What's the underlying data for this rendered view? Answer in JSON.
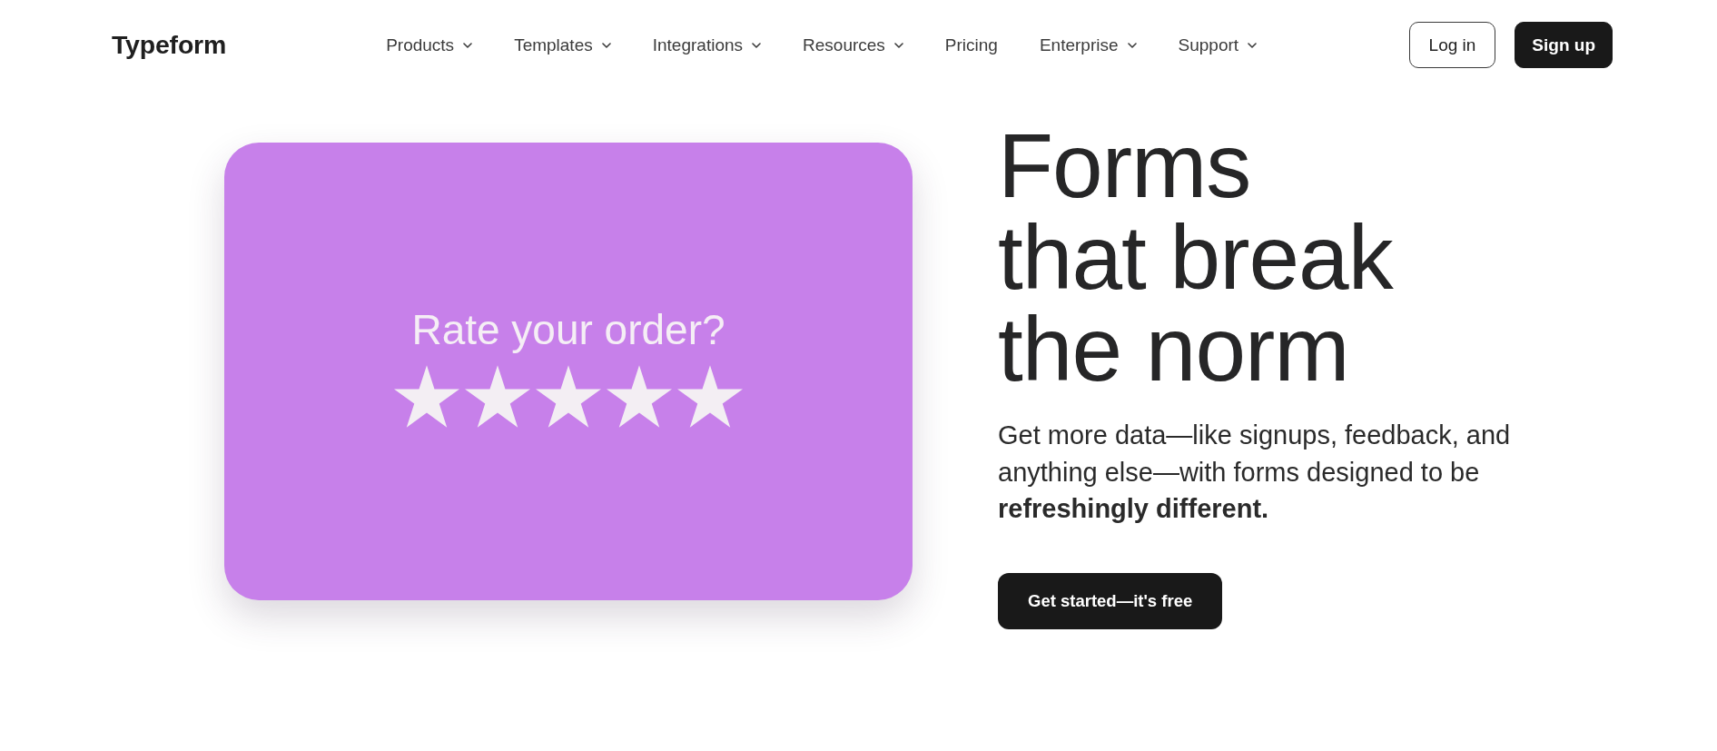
{
  "header": {
    "logo": "Typeform",
    "nav": [
      {
        "label": "Products",
        "dropdown": true
      },
      {
        "label": "Templates",
        "dropdown": true
      },
      {
        "label": "Integrations",
        "dropdown": true
      },
      {
        "label": "Resources",
        "dropdown": true
      },
      {
        "label": "Pricing",
        "dropdown": false
      },
      {
        "label": "Enterprise",
        "dropdown": true
      },
      {
        "label": "Support",
        "dropdown": true
      }
    ],
    "actions": [
      {
        "label": "Log in",
        "kind": "outline"
      },
      {
        "label": "Sign up",
        "kind": "filled"
      }
    ]
  },
  "hero": {
    "card": {
      "question": "Rate your order?",
      "stars": 5
    },
    "heading": [
      "Forms",
      "that break",
      "the norm"
    ],
    "description": "Get more data—like signups, feedback, and anything else—with forms designed to be **refreshingly different.**",
    "cta": "Get started—it's free"
  }
}
